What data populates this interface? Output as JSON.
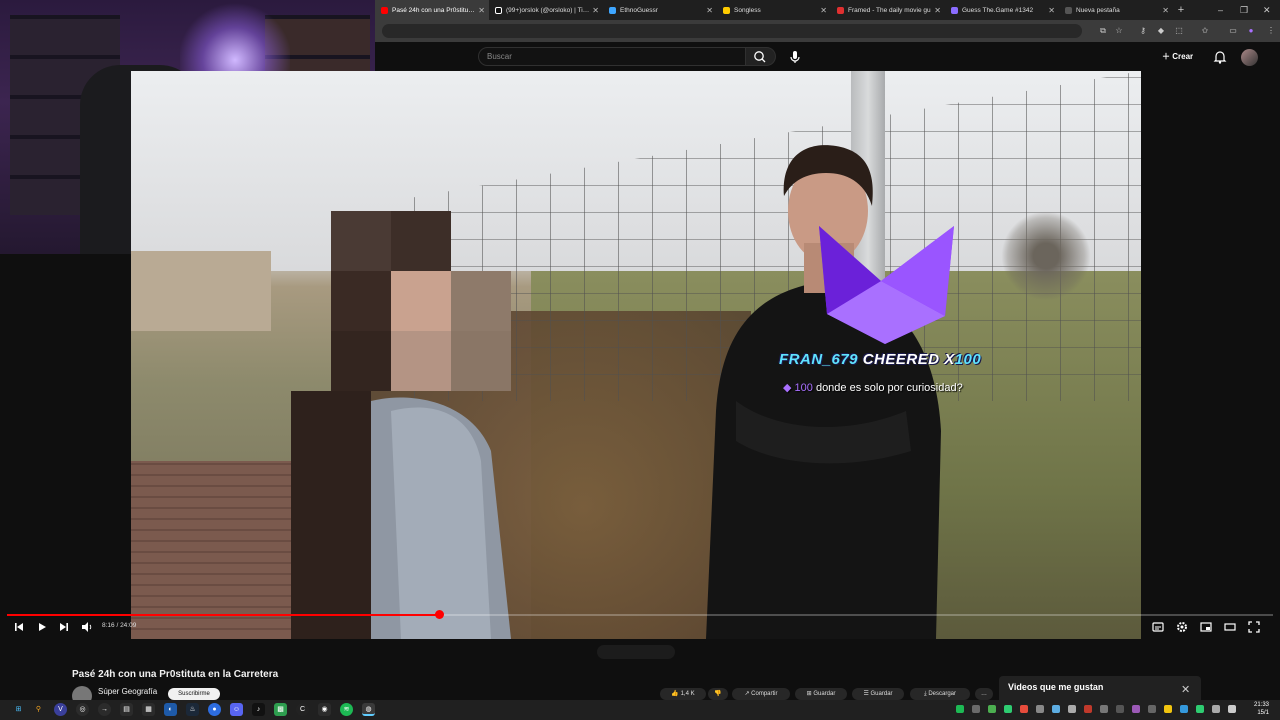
{
  "browser": {
    "tabs": [
      {
        "title": "Pasé 24h con una Pr0stituta e",
        "active": true,
        "color": "#ff0000"
      },
      {
        "title": "(99+)orslok (@orsloko) | TikTo",
        "active": false,
        "color": "#ffffff"
      },
      {
        "title": "EthnoGuessr",
        "active": false,
        "color": "#3ea6ff"
      },
      {
        "title": "Songless",
        "active": false,
        "color": "#ffcc00"
      },
      {
        "title": "Framed - The daily movie gu",
        "active": false,
        "color": "#e03030"
      },
      {
        "title": "Guess The.Game #1342",
        "active": false,
        "color": "#8a6cff"
      },
      {
        "title": "Nueva pestaña",
        "active": false,
        "color": "#555555"
      }
    ],
    "new_tab": "+",
    "window_controls": {
      "minimize": "–",
      "maximize": "❐",
      "close": "✕"
    }
  },
  "youtube": {
    "search_placeholder": "Buscar",
    "create_label": "Crear",
    "video_title": "Pasé 24h con una Pr0stituta en la Carretera",
    "channel_name": "Súper Geografía",
    "subscribe_label": "Suscribirme",
    "actions": [
      "1,4 K",
      "",
      "Compartir",
      "Guardar",
      "Guardar",
      "Descargar"
    ],
    "liked_panel_title": "Videos que me gustan"
  },
  "player": {
    "time_current": "8:16",
    "time_total": "24:09",
    "time_display": "8:16 / 24:09",
    "progress_fraction": 0.342
  },
  "cheer": {
    "username": "FRAN_679",
    "cheered": " CHEERED X",
    "amount": "100",
    "bits": "100",
    "message": " donde es solo por curiosidad?"
  },
  "taskbar": {
    "clock_time": "21:33",
    "clock_date": "15/1"
  },
  "colors": {
    "youtube_red": "#ff0000",
    "bits_purple": "#a970ff",
    "cheer_cyan": "#5fe3ff"
  }
}
